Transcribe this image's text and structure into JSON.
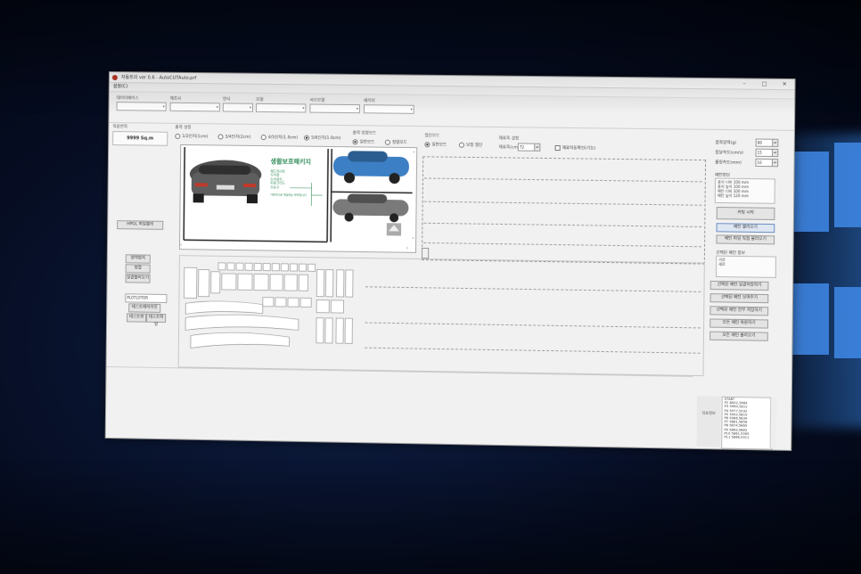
{
  "window": {
    "title": "자동트리 ver 0.6 - AutoCUTAuto.prf",
    "menu": "설정(C)"
  },
  "filters": [
    {
      "label": "데이터베이스",
      "value": ""
    },
    {
      "label": "제조사",
      "value": ""
    },
    {
      "label": "연식",
      "value": ""
    },
    {
      "label": "모델",
      "value": ""
    },
    {
      "label": "서브모델",
      "value": ""
    },
    {
      "label": "패키지",
      "value": ""
    }
  ],
  "left": {
    "area_label": "적용면적",
    "area_value": "9999 Sq.m",
    "hpgl_button": "HPGL 파일불러",
    "buttons": [
      "영역합치",
      "정렬",
      "일괄불러오기"
    ],
    "port_value": "PLOTLOTOR",
    "test_button": "테스트레이아웃",
    "small_buttons": [
      "테스트컷",
      "테스트파일"
    ]
  },
  "output": {
    "title": "출력 설정",
    "options": [
      "1/2인치(1cm)",
      "3/4인치(2cm)",
      "4/5인치(1.0cm)",
      "5/6인치(1.0cm)"
    ],
    "selected": 3
  },
  "nesting": {
    "title": "출력 방향모드",
    "options": [
      "일반모드",
      "정렬모드"
    ],
    "selected": 0
  },
  "cutmode": {
    "title": "절단모드",
    "options": [
      "일반모드",
      "보정 절단"
    ],
    "selected": 0
  },
  "material": {
    "title": "재료폭 설정",
    "width_label": "재료폭(cm)",
    "width_value": "72",
    "checkbox_label": "재료자동확인(기능)"
  },
  "preview": {
    "headline": "생활보호패키지",
    "lines": [
      "헤드라이트",
      "도어컵",
      "도어엣지",
      "트렁크리드",
      "주유구"
    ],
    "footnote": "기본적으로 제공되는 부위입니다"
  },
  "right": {
    "rows": [
      {
        "label": "흡착압력(g)",
        "value": "80"
      },
      {
        "label": "칼날속도(cm/s)",
        "value": "15"
      },
      {
        "label": "롤링속도(mm)",
        "value": "10"
      }
    ],
    "info_title": "패턴정보",
    "info_lines": [
      "용지 너비   100 mm",
      "용지 높이   100 mm",
      "패턴 너비   100 mm",
      "패턴 높이   120 mm"
    ],
    "buttons1": [
      "커팅 시작",
      "패턴 불러오기",
      "패턴 파일 직접 불러오기"
    ],
    "group_title": "선택된 패턴 정보",
    "group_lines": [
      "가로",
      "세로"
    ],
    "buttons2": [
      "선택된 패턴 일괄저장하기",
      "선택된 패턴 보여주기",
      "선택된 패턴 전부 저장하기",
      "모든 패턴 복원하기",
      "모든 패턴 불러오기"
    ]
  },
  "status": {
    "label": "좌표정보",
    "coords": [
      "START",
      "P2 8002,3984",
      "P3 5990,5812",
      "P4 5977,5032",
      "P5 5992,5819",
      "P6 5986,5834",
      "P7 5881,5856",
      "P8 5874,5869",
      "P9 5863,5883",
      "P10 5861,5900",
      "P11 5866,5911"
    ]
  }
}
